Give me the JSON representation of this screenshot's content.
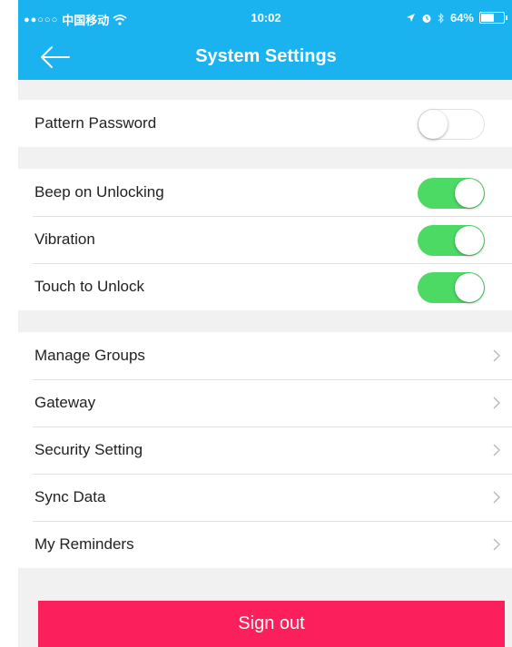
{
  "status_bar": {
    "signal": "●●○○○",
    "carrier": "中国移动",
    "wifi_icon": "wifi-icon",
    "time": "10:02",
    "location_icon": "location-arrow-icon",
    "alarm_icon": "alarm-icon",
    "bluetooth_icon": "bluetooth-icon",
    "battery": "64%",
    "battery_level": 0.64
  },
  "nav": {
    "title": "System Settings",
    "back_icon": "back-arrow-icon"
  },
  "settings": {
    "pattern_password": {
      "label": "Pattern Password",
      "enabled": false
    },
    "beep_on_unlocking": {
      "label": "Beep on Unlocking",
      "enabled": true
    },
    "vibration": {
      "label": "Vibration",
      "enabled": true
    },
    "touch_to_unlock": {
      "label": "Touch to Unlock",
      "enabled": true
    }
  },
  "menu": [
    {
      "label": "Manage Groups"
    },
    {
      "label": "Gateway"
    },
    {
      "label": "Security Setting"
    },
    {
      "label": "Sync Data"
    },
    {
      "label": "My Reminders"
    }
  ],
  "sign_out": {
    "label": "Sign out"
  },
  "colors": {
    "header": "#1ab3f0",
    "toggle_on": "#4cd964",
    "sign_out": "#fb1f5b",
    "background": "#f1f1f1"
  }
}
